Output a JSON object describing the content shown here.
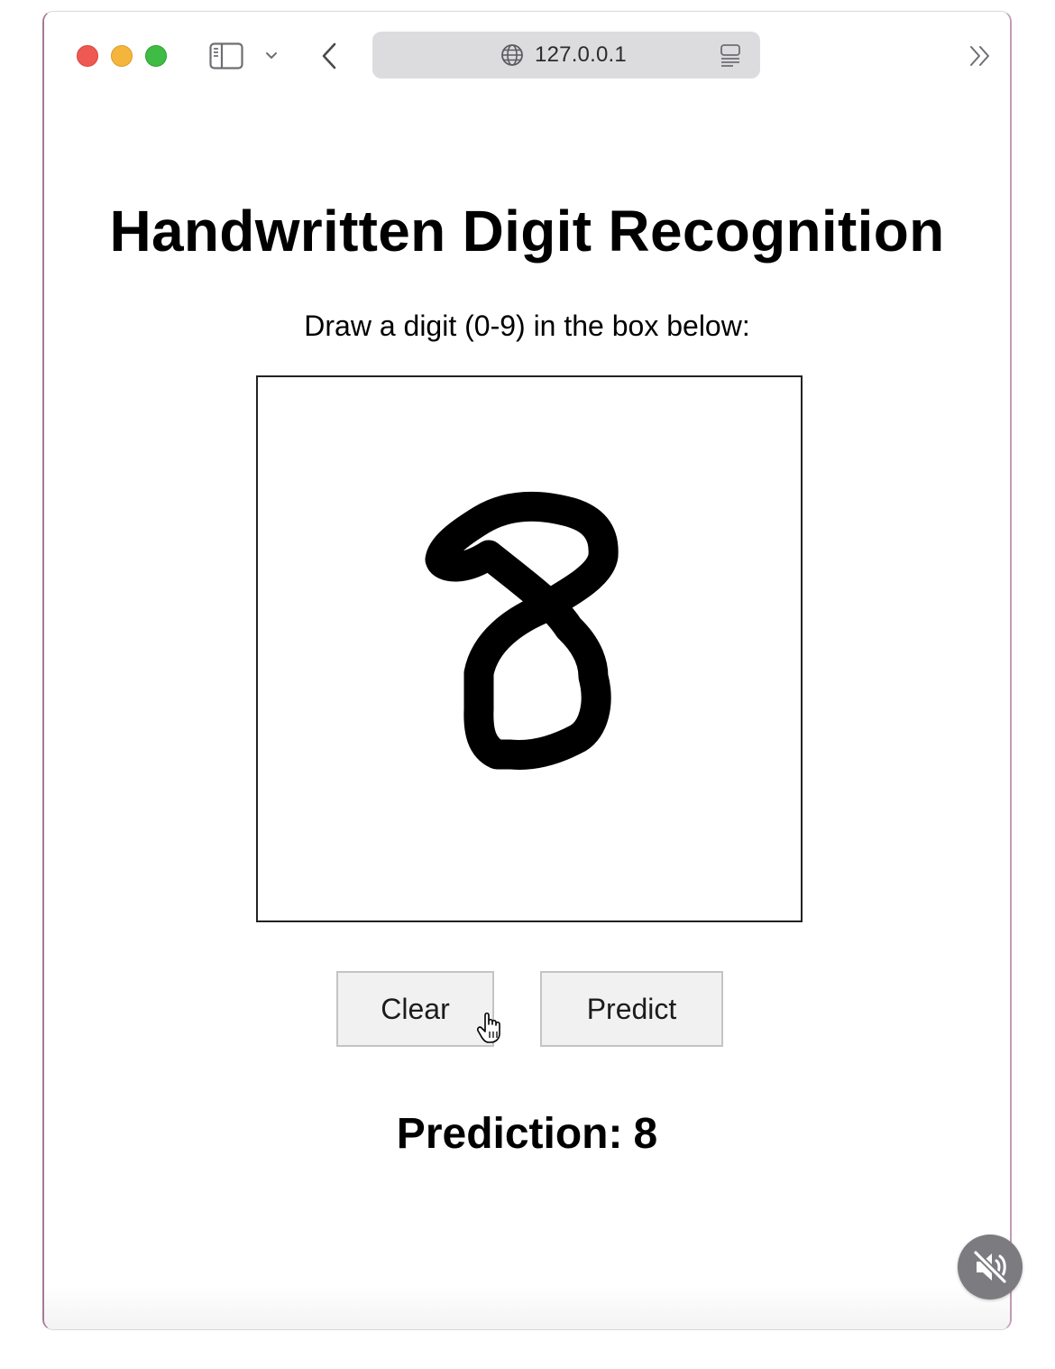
{
  "browser": {
    "url": "127.0.0.1",
    "icons": {
      "sidebar": "sidebar-icon",
      "chevron": "chevron-down-icon",
      "back": "chevron-left-icon",
      "site": "globe-icon",
      "reader": "reader-icon",
      "more": "double-chevron-right-icon"
    }
  },
  "page": {
    "title": "Handwritten Digit Recognition",
    "instruction": "Draw a digit (0-9) in the box below:",
    "drawing": {
      "digit_drawn": "8",
      "stroke_color": "#000000"
    },
    "buttons": {
      "clear_label": "Clear",
      "predict_label": "Predict"
    },
    "prediction": {
      "label": "Prediction:",
      "value": "8"
    }
  },
  "overlay": {
    "mute_icon": "speaker-muted-icon"
  },
  "colors": {
    "traffic_red": "#ee5a52",
    "traffic_yellow": "#f5b53c",
    "traffic_green": "#3fbc43",
    "address_bar_bg": "#dcdcde",
    "button_bg": "#f1f1f1"
  }
}
